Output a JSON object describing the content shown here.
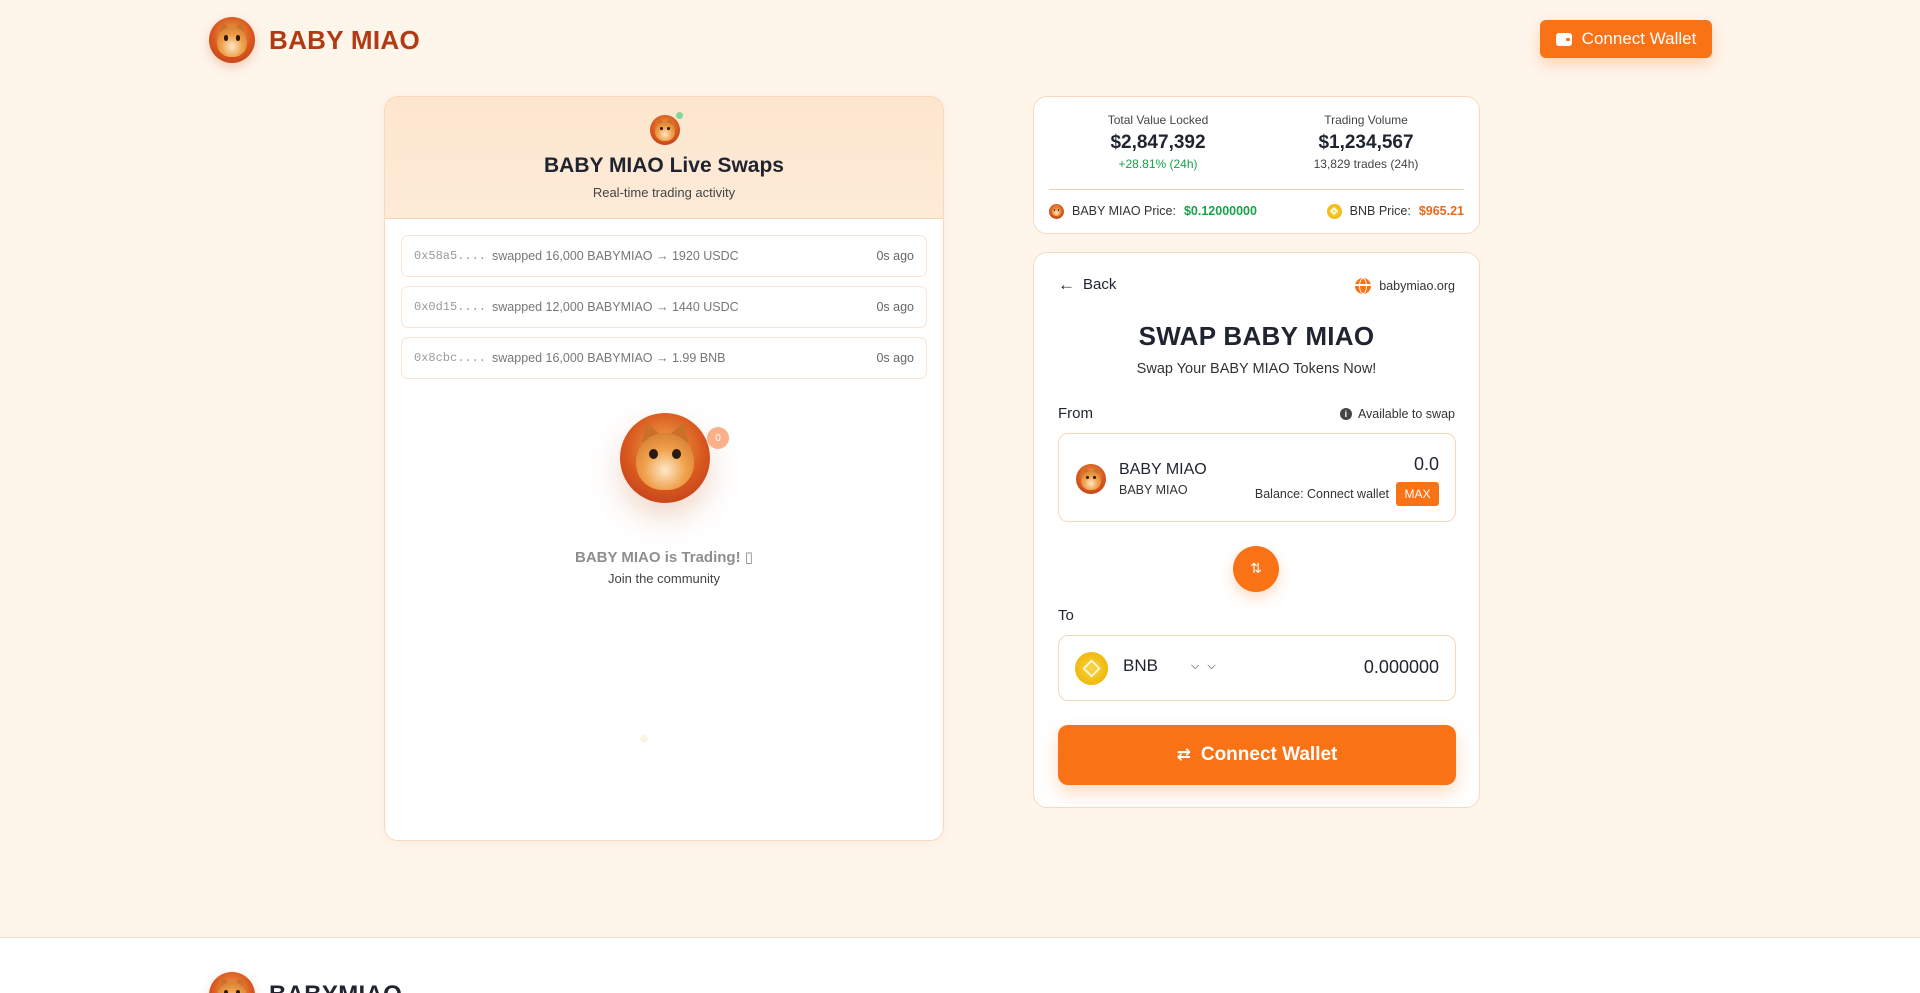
{
  "header": {
    "brand_name": "BABY MIAO",
    "connect_label": "Connect Wallet"
  },
  "live": {
    "title": "BABY MIAO Live Swaps",
    "subtitle": "Real-time trading activity",
    "swaps": [
      {
        "address": "0x58a5....",
        "text": "swapped 16,000 BABYMIAO → 1920 USDC",
        "time": "0s ago"
      },
      {
        "address": "0x0d15....",
        "text": "swapped 12,000 BABYMIAO → 1440 USDC",
        "time": "0s ago"
      },
      {
        "address": "0x8cbc....",
        "text": "swapped 16,000 BABYMIAO → 1.99 BNB",
        "time": "0s ago"
      }
    ],
    "notif_count": "0",
    "trading_text": "BABY MIAO is Trading! ▯",
    "community_text": "Join the community"
  },
  "stats": {
    "tvl_label": "Total Value Locked",
    "tvl_value": "$2,847,392",
    "tvl_change": "+28.81% (24h)",
    "volume_label": "Trading Volume",
    "volume_value": "$1,234,567",
    "volume_trades": "13,829 trades (24h)",
    "miao_price_label": "BABY MIAO Price:",
    "miao_price": "$0.12000000",
    "bnb_price_label": "BNB Price:",
    "bnb_price": "$965.21",
    "colors": {
      "positive": "#16a34a",
      "bnb_price": "#ea6a1a"
    }
  },
  "swap": {
    "back_label": "Back",
    "site": "babymiao.org",
    "title": "SWAP BABY MIAO",
    "subtitle": "Swap Your BABY MIAO Tokens Now!",
    "from_label": "From",
    "available_label": "Available to swap",
    "from_token": "BABY MIAO",
    "from_token_sub": "BABY MIAO",
    "from_amount": "0.0",
    "balance_text": "Balance: Connect wallet",
    "max_label": "MAX",
    "to_label": "To",
    "to_token": "BNB",
    "to_amount": "0.000000",
    "connect_label": "Connect Wallet",
    "accent_color": "#f97316"
  },
  "footer": {
    "brand_name": "BABYMIAO"
  }
}
